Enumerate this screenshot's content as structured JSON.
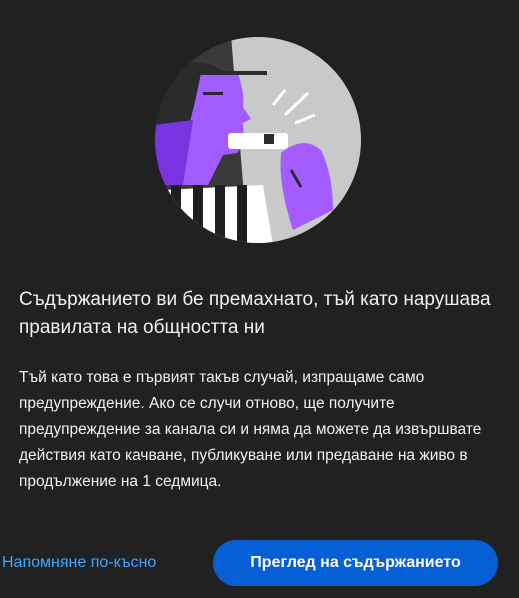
{
  "dialog": {
    "title": "Съдържанието ви бе премахнато, тъй като нарушава правилата на общността ни",
    "body": "Тъй като това е първият такъв случай, изпращаме само предупреждение. Ако се случи отново, ще получите предупреждение за канала си и няма да можете да извършвате действия като качване, публикуване или предаване на живо в продължение на 1 седмица.",
    "illustration_icon": "whistle-referee-illustration",
    "colors": {
      "background": "#212121",
      "accent_link": "#3ea6ff",
      "primary_button": "#065fd4",
      "illustration_purple": "#a35cff",
      "illustration_gray": "#c9c9c9"
    }
  },
  "actions": {
    "remind_later_label": "Напомняне по-късно",
    "review_content_label": "Преглед на съдържанието"
  }
}
